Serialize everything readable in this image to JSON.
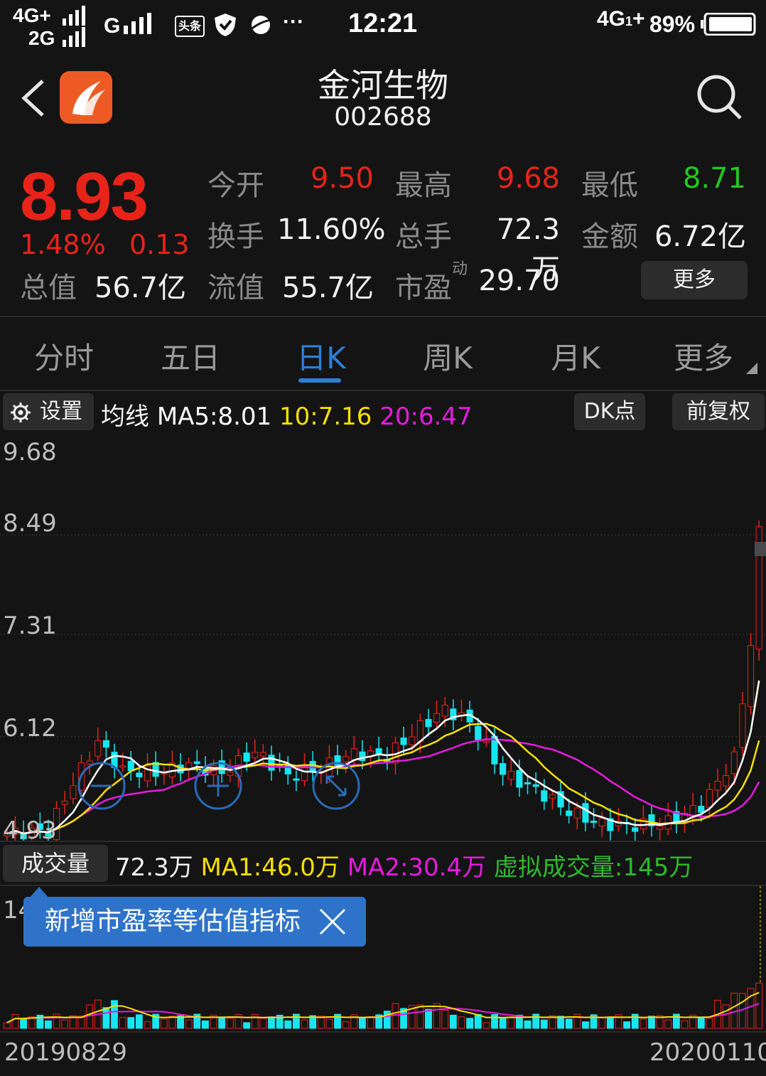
{
  "status_bar": {
    "net1": "4G+",
    "net2": "2G",
    "net3": "G",
    "app_badge": "头条",
    "dots": "···",
    "time": "12:21",
    "net_right": "4G",
    "battery": "89%"
  },
  "header": {
    "name": "金河生物",
    "code": "002688"
  },
  "quote": {
    "price": "8.93",
    "change_pct": "1.48%",
    "change": "0.13",
    "open_label": "今开",
    "open": "9.50",
    "high_label": "最高",
    "high": "9.68",
    "low_label": "最低",
    "low": "8.71",
    "turnover_label": "换手",
    "turnover": "11.60%",
    "volume_label": "总手",
    "volume": "72.3万",
    "amount_label": "金额",
    "amount": "6.72亿",
    "mktcap_label": "总值",
    "mktcap": "56.7亿",
    "float_label": "流值",
    "float": "55.7亿",
    "pe_label": "市盈",
    "pe_sup": "动",
    "pe": "29.70",
    "more_label": "更多"
  },
  "tabs": [
    {
      "label": "分时"
    },
    {
      "label": "五日"
    },
    {
      "label": "日K"
    },
    {
      "label": "周K"
    },
    {
      "label": "月K"
    },
    {
      "label": "更多"
    }
  ],
  "active_tab": "日K",
  "ma_bar": {
    "settings_label": "设置",
    "prefix": "均线",
    "ma5": "MA5:8.01",
    "ma10": "10:7.16",
    "ma20": "20:6.47",
    "dk_label": "DK点",
    "fq_label": "前复权"
  },
  "price_axis": [
    "9.68",
    "8.49",
    "7.31",
    "6.12",
    "4.93"
  ],
  "volume_bar": {
    "label": "成交量",
    "value": "72.3万",
    "ma1": "MA1:46.0万",
    "ma2": "MA2:30.4万",
    "virtual": "虚拟成交量:145万"
  },
  "volume_axis_top": "14",
  "tooltip": {
    "text": "新增市盈率等估值指标"
  },
  "date_start": "20190829",
  "date_end": "20200110",
  "colors": {
    "up": "#e8231a",
    "down": "#17e6f0",
    "ma5": "#ffffff",
    "ma10": "#f5e000",
    "ma20": "#e61be0",
    "accent": "#2b7fd6"
  },
  "icons": [
    "back-arrow-icon",
    "app-logo-icon",
    "search-icon",
    "gear-icon",
    "zoom-out-icon",
    "zoom-in-icon",
    "fullscreen-icon",
    "close-icon"
  ]
}
